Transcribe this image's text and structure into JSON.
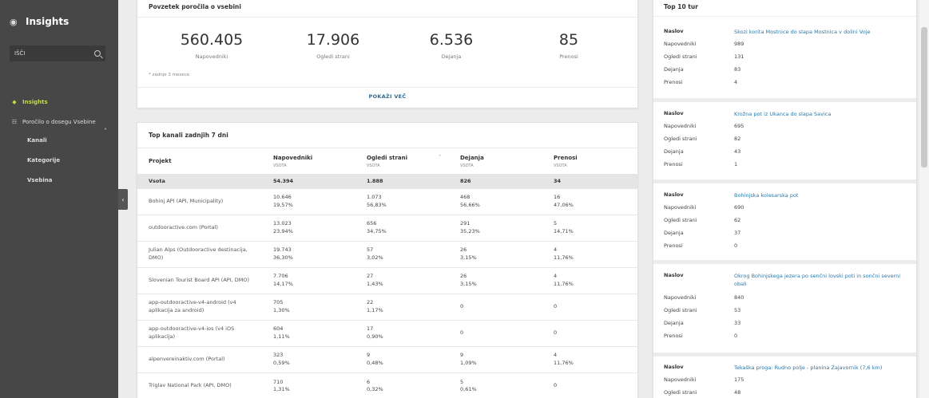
{
  "sidebar": {
    "app_title": "Insights",
    "search_label": "IŠČI",
    "items": [
      {
        "label": "Insights"
      },
      {
        "label": "Poročilo o dosegu Vsebine"
      }
    ],
    "sub_items": [
      {
        "label": "Kanali"
      },
      {
        "label": "Kategorije"
      },
      {
        "label": "Vsebina"
      }
    ]
  },
  "summary": {
    "title": "Povzetek poročila o vsebini",
    "stats": [
      {
        "value": "560.405",
        "label": "Napovedniki"
      },
      {
        "value": "17.906",
        "label": "Ogledi strani"
      },
      {
        "value": "6.536",
        "label": "Dejanja"
      },
      {
        "value": "85",
        "label": "Prenosi"
      }
    ],
    "note": "* zadnje 3 mesece",
    "more_label": "POKAŽI VEČ"
  },
  "channels": {
    "title": "Top kanali zadnjih 7 dni",
    "columns": [
      {
        "label": "Projekt",
        "sub": ""
      },
      {
        "label": "Napovedniki",
        "sub": "VSOTA"
      },
      {
        "label": "Ogledi strani",
        "sub": "VSOTA"
      },
      {
        "label": "Dejanja",
        "sub": "VSOTA"
      },
      {
        "label": "Prenosi",
        "sub": "VSOTA"
      }
    ],
    "total": {
      "label": "Vsota",
      "v1": "54.394",
      "v2": "1.888",
      "v3": "826",
      "v4": "34"
    },
    "rows": [
      {
        "project": "Bohinj API (API, Municipality)",
        "v1": "10.646",
        "p1": "19,57%",
        "v2": "1.073",
        "p2": "56,83%",
        "v3": "468",
        "p3": "56,66%",
        "v4": "16",
        "p4": "47,06%"
      },
      {
        "project": "outdooractive.com (Portal)",
        "v1": "13.023",
        "p1": "23,94%",
        "v2": "656",
        "p2": "34,75%",
        "v3": "291",
        "p3": "35,23%",
        "v4": "5",
        "p4": "14,71%"
      },
      {
        "project": "Julian Alps (Outdooractive destinacija, DMO)",
        "v1": "19.743",
        "p1": "36,30%",
        "v2": "57",
        "p2": "3,02%",
        "v3": "26",
        "p3": "3,15%",
        "v4": "4",
        "p4": "11,76%"
      },
      {
        "project": "Slovenian Tourist Board API (API, DMO)",
        "v1": "7.706",
        "p1": "14,17%",
        "v2": "27",
        "p2": "1,43%",
        "v3": "26",
        "p3": "3,15%",
        "v4": "4",
        "p4": "11,76%"
      },
      {
        "project": "app-outdooractive-v4-android (v4 aplikacija za android)",
        "v1": "705",
        "p1": "1,30%",
        "v2": "22",
        "p2": "1,17%",
        "v3": "0",
        "p3": "",
        "v4": "0",
        "p4": ""
      },
      {
        "project": "app-outdooractive-v4-ios (v4 iOS aplikacija)",
        "v1": "604",
        "p1": "1,11%",
        "v2": "17",
        "p2": "0,90%",
        "v3": "0",
        "p3": "",
        "v4": "0",
        "p4": ""
      },
      {
        "project": "alpenvereinaktiv.com (Portal)",
        "v1": "323",
        "p1": "0,59%",
        "v2": "9",
        "p2": "0,48%",
        "v3": "9",
        "p3": "1,09%",
        "v4": "4",
        "p4": "11,76%"
      },
      {
        "project": "Triglav National Park (API, DMO)",
        "v1": "710",
        "p1": "1,31%",
        "v2": "6",
        "p2": "0,32%",
        "v3": "5",
        "p3": "0,61%",
        "v4": "0",
        "p4": ""
      }
    ]
  },
  "tours": {
    "title": "Top 10 tur",
    "keys": {
      "title": "Naslov",
      "teasers": "Napovedniki",
      "views": "Ogledi strani",
      "actions": "Dejanja",
      "downloads": "Prenosi"
    },
    "items": [
      {
        "title": "Skozi korita Mostnice do slapa Mostnica v dolini Voje",
        "teasers": "989",
        "views": "131",
        "actions": "83",
        "downloads": "4"
      },
      {
        "title": "Krožna pot iz Ukanca do slapa Savica",
        "teasers": "695",
        "views": "82",
        "actions": "43",
        "downloads": "1"
      },
      {
        "title": "Bohinjska kolesarska pot",
        "teasers": "690",
        "views": "62",
        "actions": "37",
        "downloads": "0"
      },
      {
        "title": "Okrog Bohinjskega jezera po senčni lovski poti in sončni severni obali",
        "teasers": "840",
        "views": "53",
        "actions": "33",
        "downloads": "0"
      },
      {
        "title": "Tekaška proga: Rudno polje - planina Zajavornik (7,6 km)",
        "teasers": "175",
        "views": "48",
        "actions": "",
        "downloads": ""
      }
    ]
  }
}
